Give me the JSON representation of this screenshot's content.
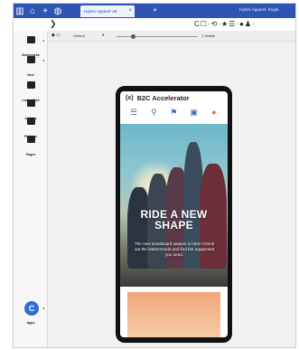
{
  "window": {
    "tab_title": "Hybris Apparel UK",
    "tab_close": "×",
    "new_tab": "+",
    "top_right": "Hybris Apparel: Engla"
  },
  "toolbar": {
    "chevron": "❯",
    "tools": "C☐·⟲·★☰·●♟·"
  },
  "sidebar": {
    "items": [
      {
        "label": "Bookmarks",
        "icon": "bookmark-icon"
      },
      {
        "label": "New",
        "icon": "new-icon"
      },
      {
        "label": "Last edited",
        "icon": "history-icon"
      },
      {
        "label": "Articles",
        "icon": "articles-icon"
      },
      {
        "label": "Pictures",
        "icon": "pictures-icon"
      },
      {
        "label": "Pages",
        "icon": "pages-icon"
      }
    ],
    "apps_label": "Apps",
    "launcher": "C"
  },
  "viewport": {
    "icons": "◆ ▭",
    "device": "Default",
    "caret": "▾",
    "mobile": "▯ Mobile"
  },
  "site": {
    "logo": "(x)",
    "brand": "B2C Accelerator",
    "nav": [
      "menu-icon",
      "search-icon",
      "location-icon",
      "store-icon",
      "cart-icon"
    ],
    "hero_title_line1": "RIDE A NEW",
    "hero_title_line2": "SHAPE",
    "hero_text": "The new snowboard season is here! Check out the latest trends and find the equipment you need."
  },
  "colors": {
    "tabbar": "#2f55b4",
    "nav_accent": "#3b6fb5",
    "cart_accent": "#e07a2e"
  }
}
